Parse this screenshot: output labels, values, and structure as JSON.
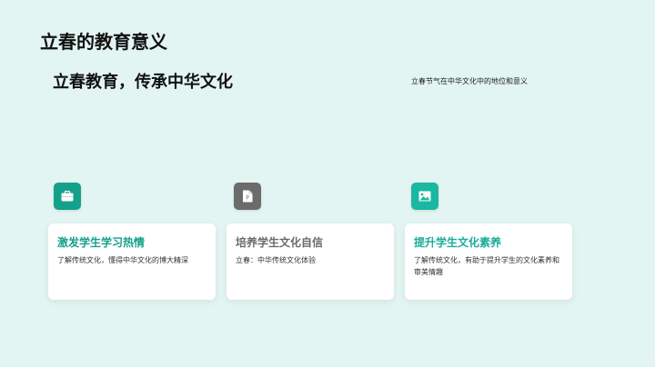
{
  "slide": {
    "title": "立春的教育意义",
    "subtitle": "立春教育，传承中华文化",
    "side_note": "立春节气在中华文化中的地位和意义"
  },
  "cards": [
    {
      "icon": "briefcase-icon",
      "icon_color": "#15a08b",
      "title": "激发学生学习热情",
      "title_color": "#15a08b",
      "body": "了解传统文化，懂得中华文化的博大精深"
    },
    {
      "icon": "document-icon",
      "icon_color": "#6b6b6b",
      "title": "培养学生文化自信",
      "title_color": "#6b6b6b",
      "body": "立春：中华传统文化体验"
    },
    {
      "icon": "image-icon",
      "icon_color": "#1bb7a3",
      "title": "提升学生文化素养",
      "title_color": "#19ad9a",
      "body": "了解传统文化，有助于提升学生的文化素养和审美情趣"
    }
  ]
}
